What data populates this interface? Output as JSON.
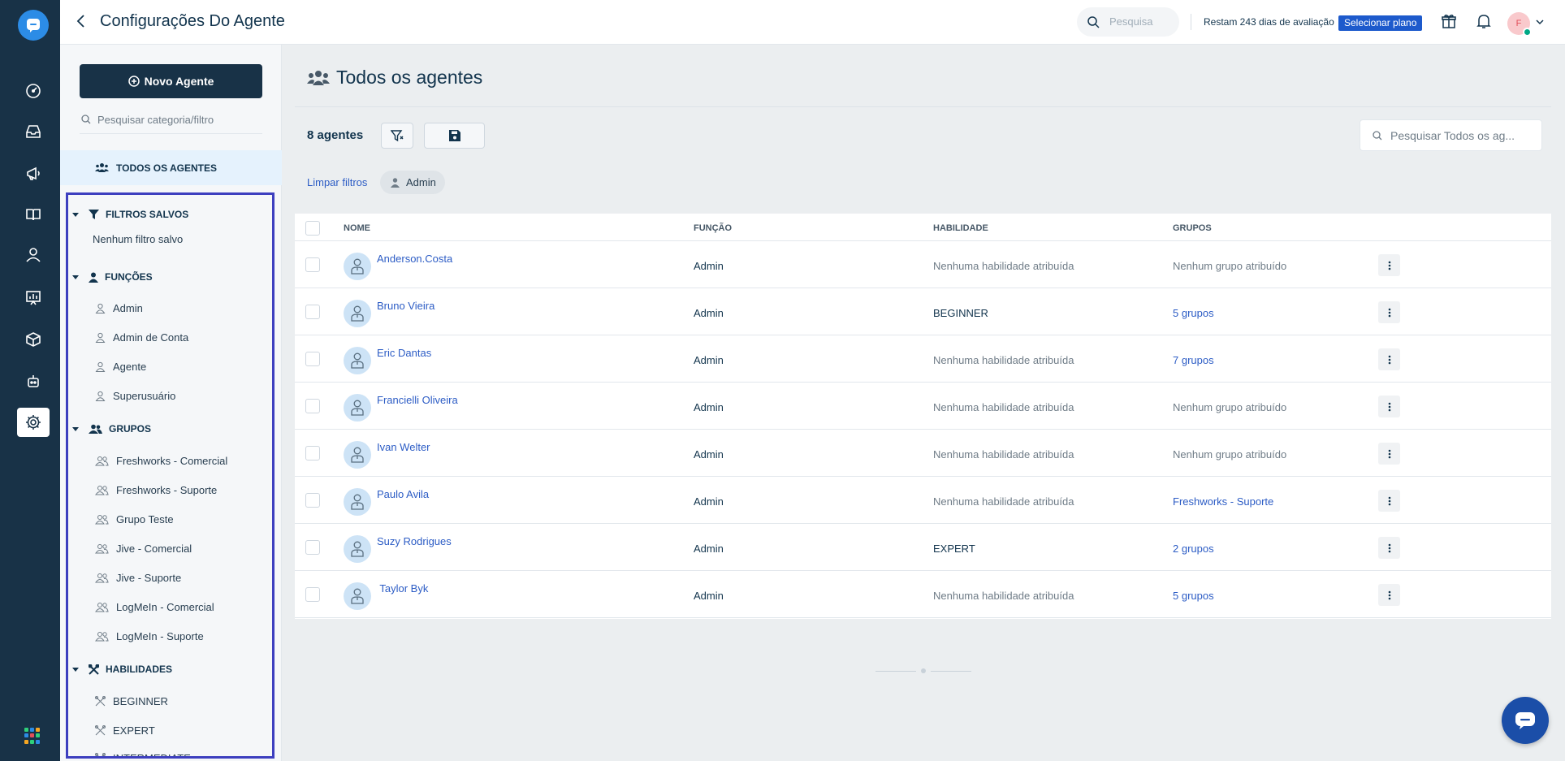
{
  "header": {
    "title": "Configurações Do Agente",
    "search_placeholder": "Pesquisa",
    "trial_text": "Restam 243 dias de avaliação",
    "plan_button": "Selecionar plano",
    "avatar_initial": "F"
  },
  "sidebar": {
    "new_agent_button": "Novo Agente",
    "category_search_placeholder": "Pesquisar categoria/filtro",
    "all_agents": "TODOS OS AGENTES",
    "saved_filters": {
      "title": "FILTROS SALVOS",
      "empty_text": "Nenhum filtro salvo"
    },
    "roles": {
      "title": "FUNÇÕES",
      "items": [
        "Admin",
        "Admin de Conta",
        "Agente",
        "Superusuário"
      ]
    },
    "groups": {
      "title": "GRUPOS",
      "items": [
        "Freshworks - Comercial",
        "Freshworks - Suporte",
        "Grupo Teste",
        "Jive - Comercial",
        "Jive - Suporte",
        "LogMeIn - Comercial",
        "LogMeIn - Suporte"
      ]
    },
    "skills": {
      "title": "HABILIDADES",
      "items": [
        "BEGINNER",
        "EXPERT",
        "INTERMEDIATE"
      ]
    }
  },
  "main": {
    "heading": "Todos os agentes",
    "count_label": "8 agentes",
    "table_search_placeholder": "Pesquisar Todos os ag...",
    "clear_filters": "Limpar filtros",
    "active_filter": "Admin",
    "columns": {
      "name": "NOME",
      "role": "FUNÇÃO",
      "skill": "HABILIDADE",
      "groups": "GRUPOS"
    },
    "rows": [
      {
        "name": "Anderson.Costa",
        "role": "Admin",
        "skill": "Nenhuma habilidade atribuída",
        "groups": "Nenhum grupo atribuído"
      },
      {
        "name": "Bruno Vieira",
        "role": "Admin",
        "skill": "BEGINNER",
        "groups": "5 grupos"
      },
      {
        "name": "Eric Dantas",
        "role": "Admin",
        "skill": "Nenhuma habilidade atribuída",
        "groups": "7 grupos"
      },
      {
        "name": "Francielli Oliveira",
        "role": "Admin",
        "skill": "Nenhuma habilidade atribuída",
        "groups": "Nenhum grupo atribuído"
      },
      {
        "name": "Ivan Welter",
        "role": "Admin",
        "skill": "Nenhuma habilidade atribuída",
        "groups": "Nenhum grupo atribuído"
      },
      {
        "name": "Paulo Avila",
        "role": "Admin",
        "skill": "Nenhuma habilidade atribuída",
        "groups": "Freshworks - Suporte"
      },
      {
        "name": "Suzy Rodrigues",
        "role": "Admin",
        "skill": "EXPERT",
        "groups": "2 grupos"
      },
      {
        "name": " Taylor Byk",
        "role": "Admin",
        "skill": "Nenhuma habilidade atribuída",
        "groups": "5 grupos"
      }
    ]
  },
  "colors": {
    "rail": "#183247",
    "accent": "#2c5cc5",
    "selection_outline": "#3d3fbf",
    "plan_button": "#1d5acc"
  },
  "icons": [
    "chat-logo-icon",
    "dashboard-icon",
    "inbox-icon",
    "megaphone-icon",
    "book-icon",
    "contact-icon",
    "reports-icon",
    "cube-icon",
    "bot-icon",
    "gear-icon",
    "apps-grid-icon",
    "back-arrow-icon",
    "search-icon",
    "gift-icon",
    "bell-icon",
    "filter-icon",
    "save-icon",
    "user-icon",
    "group-icon",
    "skill-icon",
    "more-vertical-icon",
    "chat-bubble-icon"
  ]
}
